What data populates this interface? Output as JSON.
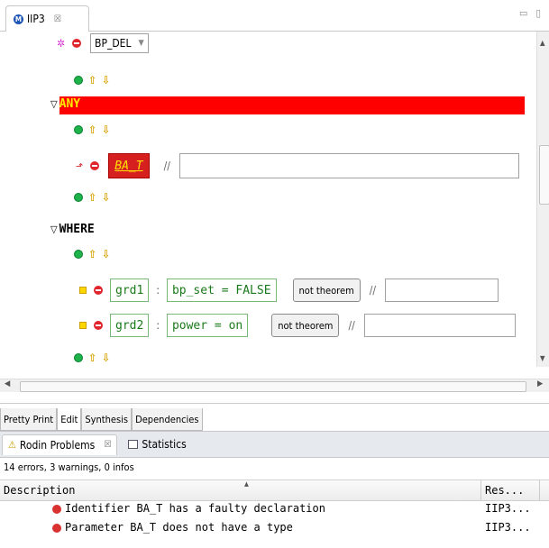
{
  "editor": {
    "tab_title": "IIP3",
    "tab_close": "☒",
    "window_controls": "▭ ▯",
    "bp_del": "BP_DEL",
    "any_label": "ANY",
    "param_name": "BA_T",
    "comment_marker": "//",
    "where_label": "WHERE",
    "collapse_glyph": "▽",
    "guards": [
      {
        "label": "grd1",
        "predicate": "bp_set = FALSE",
        "button": "not theorem"
      },
      {
        "label": "grd2",
        "predicate": "power = on",
        "button": "not theorem"
      }
    ],
    "colon": ":"
  },
  "page_tabs": [
    "Pretty Print",
    "Edit",
    "Synthesis",
    "Dependencies"
  ],
  "problems": {
    "tab_label": "Rodin Problems",
    "tab_close": "☒",
    "statistics_label": "Statistics",
    "summary": "14 errors, 3 warnings, 0 infos",
    "columns": {
      "description": "Description",
      "resource": "Res..."
    },
    "rows": [
      {
        "description": "Identifier BA_T has a faulty declaration",
        "resource": "IIP3..."
      },
      {
        "description": "Parameter BA_T does not have a type",
        "resource": "IIP3..."
      }
    ]
  },
  "colors": {
    "any_banner": "#ff0000",
    "error": "#d93030",
    "add": "#1db34a",
    "arrow": "#d8a100"
  }
}
